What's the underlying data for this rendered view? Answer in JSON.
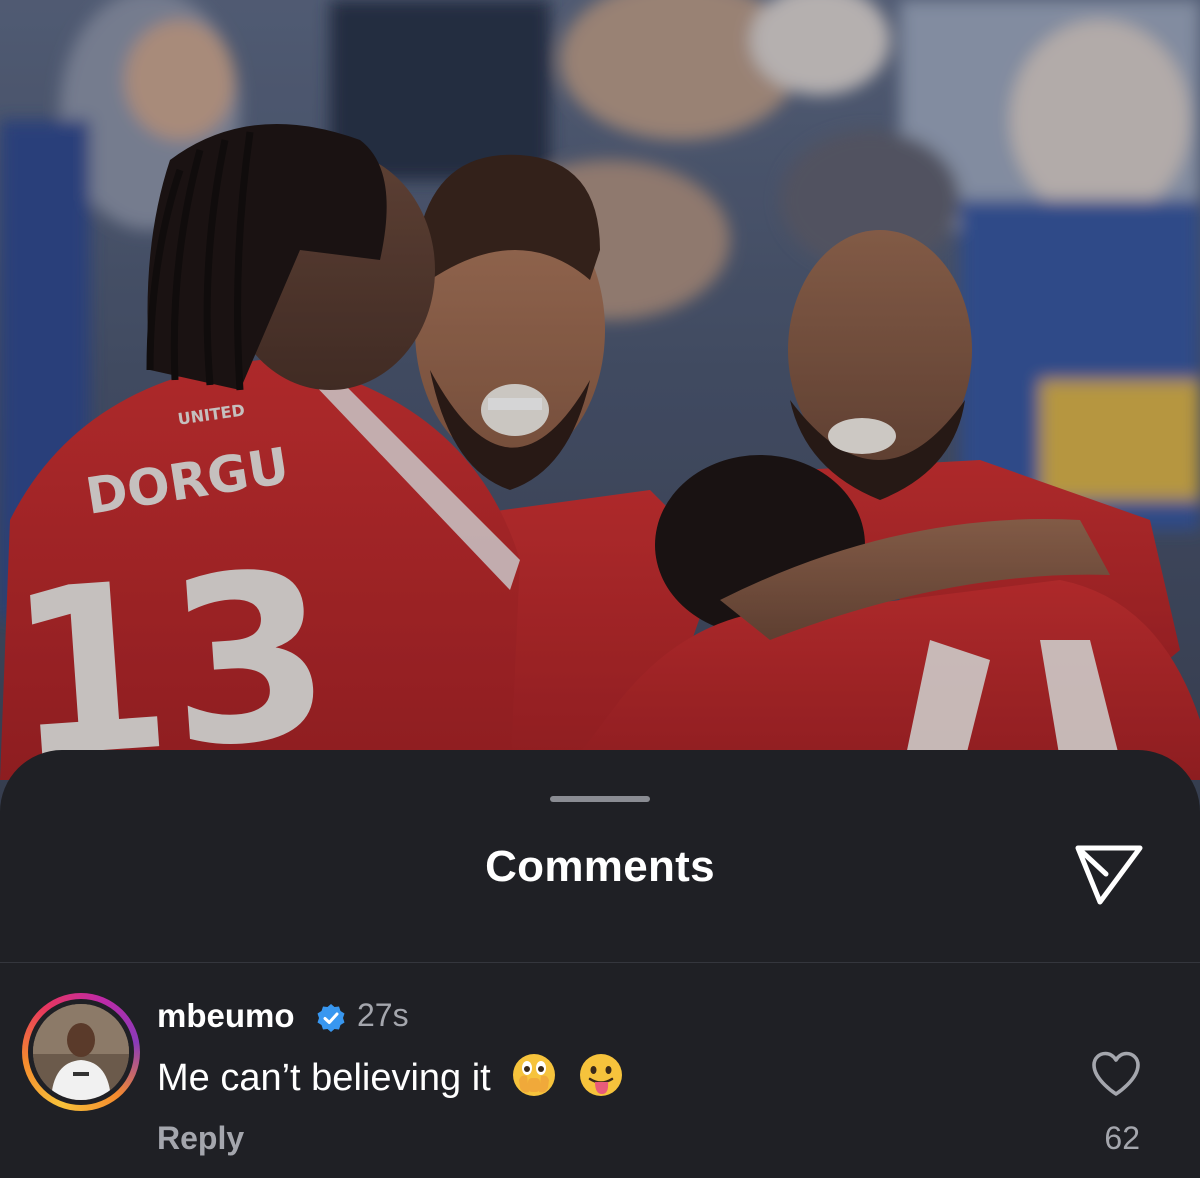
{
  "post": {
    "photo_alt": "photo-players-celebrating",
    "jersey_name_left": "DORGU",
    "jersey_number_left": "13",
    "jersey_badge": "UNITED"
  },
  "sheet": {
    "title": "Comments",
    "share_icon": "send-paper-plane-icon"
  },
  "comments": [
    {
      "username": "mbeumo",
      "verified": true,
      "time": "27s",
      "text": "Me can’t believing it",
      "emojis": [
        "face-with-open-eyes-and-hand-over-mouth",
        "face-with-tongue"
      ],
      "reply_label": "Reply",
      "like_count": "62"
    }
  ],
  "colors": {
    "sheet_background": "#1f2025",
    "text_primary": "#ffffff",
    "text_secondary": "#a4a6ad",
    "verified_blue": "#3897f0",
    "jersey_red": "#c7282a"
  }
}
